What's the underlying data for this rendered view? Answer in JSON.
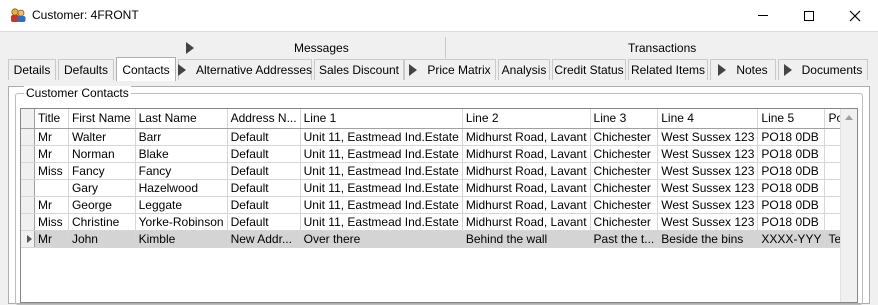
{
  "window": {
    "title": "Customer: 4FRONT",
    "minimize_icon": "minimize-icon",
    "maximize_icon": "maximize-icon",
    "close_icon": "close-icon"
  },
  "tabs": {
    "group_messages": "Messages",
    "group_transactions": "Transactions",
    "details": "Details",
    "defaults": "Defaults",
    "contacts": "Contacts",
    "alternative_addresses": "Alternative Addresses",
    "sales_discount": "Sales Discount",
    "price_matrix": "Price Matrix",
    "analysis": "Analysis",
    "credit_status": "Credit Status",
    "related_items": "Related Items",
    "notes": "Notes",
    "documents": "Documents"
  },
  "contacts_group": {
    "label": "Customer Contacts",
    "columns": [
      "Title",
      "First Name",
      "Last Name",
      "Address N...",
      "Line 1",
      "Line 2",
      "Line 3",
      "Line 4",
      "Line 5",
      "Pos"
    ],
    "rows": [
      [
        "Mr",
        "Walter",
        "Barr",
        "Default",
        "Unit 11, Eastmead Ind.Estate",
        "Midhurst Road, Lavant",
        "Chichester",
        "West Sussex 123",
        "PO18 0DB",
        ""
      ],
      [
        "Mr",
        "Norman",
        "Blake",
        "Default",
        "Unit 11, Eastmead Ind.Estate",
        "Midhurst Road, Lavant",
        "Chichester",
        "West Sussex 123",
        "PO18 0DB",
        ""
      ],
      [
        "Miss",
        "Fancy",
        "Fancy",
        "Default",
        "Unit 11, Eastmead Ind.Estate",
        "Midhurst Road, Lavant",
        "Chichester",
        "West Sussex 123",
        "PO18 0DB",
        ""
      ],
      [
        "",
        "Gary",
        "Hazelwood",
        "Default",
        "Unit 11, Eastmead Ind.Estate",
        "Midhurst Road, Lavant",
        "Chichester",
        "West Sussex 123",
        "PO18 0DB",
        ""
      ],
      [
        "Mr",
        "George",
        "Leggate",
        "Default",
        "Unit 11, Eastmead Ind.Estate",
        "Midhurst Road, Lavant",
        "Chichester",
        "West Sussex 123",
        "PO18 0DB",
        ""
      ],
      [
        "Miss",
        "Christine",
        "Yorke-Robinson",
        "Default",
        "Unit 11, Eastmead Ind.Estate",
        "Midhurst Road, Lavant",
        "Chichester",
        "West Sussex 123",
        "PO18 0DB",
        ""
      ],
      [
        "Mr",
        "John",
        "Kimble",
        "New Addr...",
        "Over there",
        "Behind the wall",
        "Past the t...",
        "Beside the bins",
        "XXXX-YYY",
        "Tea"
      ]
    ],
    "selected_row": 6
  },
  "colors": {
    "selected_row": "#d4d4d4",
    "window_bg": "#f0f0f0"
  }
}
